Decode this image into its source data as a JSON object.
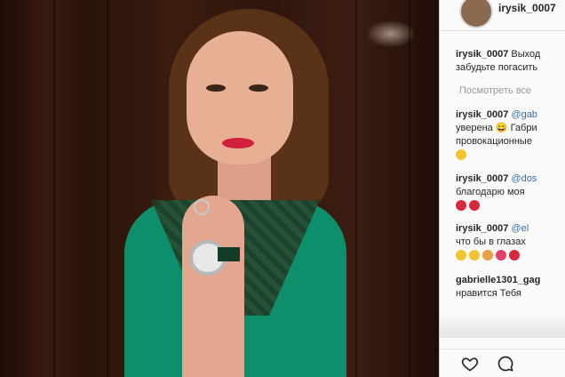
{
  "instagram": {
    "username": "irysik_0007",
    "view_all": "Посмотреть все",
    "comments": [
      {
        "user": "irysik_0007",
        "text1": "Выход",
        "text2": "забудьте погасить"
      },
      {
        "user": "irysik_0007",
        "mention": "@gab",
        "text1": "",
        "text2": "уверена 😄 Габри",
        "text3": "провокационные"
      },
      {
        "user": "irysik_0007",
        "mention": "@dos",
        "text2": "благодарю моя"
      },
      {
        "user": "irysik_0007",
        "mention": "@el",
        "text2": "что бы в глазах"
      },
      {
        "user": "gabrielle1301_gag",
        "text2": "нравится Тебя"
      }
    ]
  }
}
